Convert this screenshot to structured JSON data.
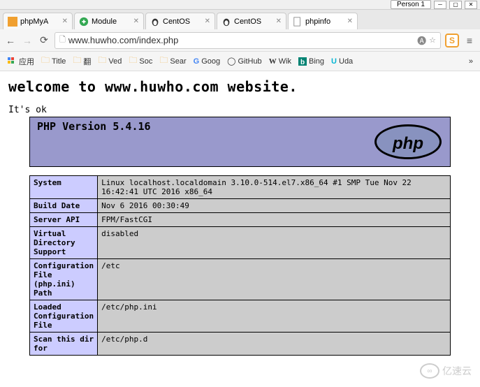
{
  "window": {
    "person_label": "Person 1"
  },
  "tabs": [
    {
      "label": "phpMyA",
      "icon_color": "#f0a030"
    },
    {
      "label": "Module",
      "icon_color": "#4285F4"
    },
    {
      "label": "CentOS",
      "icon_color": "#333"
    },
    {
      "label": "CentOS",
      "icon_color": "#333"
    },
    {
      "label": "phpinfo",
      "icon_color": "#888",
      "active": true
    }
  ],
  "url": "www.huwho.com/index.php",
  "bookmarks": [
    {
      "label": "应用",
      "type": "apps"
    },
    {
      "label": "Title",
      "type": "folder"
    },
    {
      "label": "翻",
      "type": "folder"
    },
    {
      "label": "Ved",
      "type": "folder"
    },
    {
      "label": "Soc",
      "type": "folder"
    },
    {
      "label": "Sear",
      "type": "folder"
    },
    {
      "label": "Goog",
      "type": "google"
    },
    {
      "label": "GitHub",
      "type": "github"
    },
    {
      "label": "Wik",
      "type": "wiki"
    },
    {
      "label": "Bing",
      "type": "bing"
    },
    {
      "label": "Uda",
      "type": "uda"
    }
  ],
  "page": {
    "title": "welcome to www.huwho.com website.",
    "its_ok": "It's ok",
    "php_version": "PHP Version 5.4.16",
    "info_rows": [
      {
        "key": "System",
        "value": "Linux localhost.localdomain 3.10.0-514.el7.x86_64 #1 SMP Tue Nov 22 16:42:41 UTC 2016 x86_64"
      },
      {
        "key": "Build Date",
        "value": "Nov 6 2016 00:30:49"
      },
      {
        "key": "Server API",
        "value": "FPM/FastCGI"
      },
      {
        "key": "Virtual Directory Support",
        "value": "disabled"
      },
      {
        "key": "Configuration File (php.ini) Path",
        "value": "/etc"
      },
      {
        "key": "Loaded Configuration File",
        "value": "/etc/php.ini"
      },
      {
        "key": "Scan this dir for",
        "value": "/etc/php.d"
      }
    ]
  },
  "watermark": "亿速云"
}
